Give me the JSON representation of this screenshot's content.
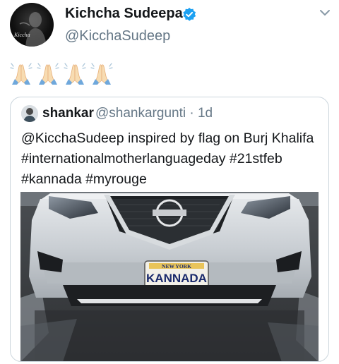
{
  "tweet": {
    "display_name": "Kichcha Sudeepa",
    "handle": "@KicchaSudeep",
    "avatar_text": "Kiccha",
    "emoji_icons": [
      "folded-hands-icon",
      "folded-hands-icon",
      "folded-hands-icon",
      "folded-hands-icon"
    ]
  },
  "quoted": {
    "display_name": "shankar",
    "handle_time": "@shankargunti · 1d",
    "text_lines": [
      "@KicchaSudeep inspired by flag on Burj Khalifa",
      "#internationalmotherlanguageday #21stfeb",
      "#kannada #myrouge"
    ],
    "photo": {
      "plate_top": "NEW YORK",
      "plate_main": "KANNADA"
    }
  },
  "colors": {
    "verified": "#1da1f2",
    "secondary_text": "#657786",
    "border": "#ccd6dd"
  }
}
